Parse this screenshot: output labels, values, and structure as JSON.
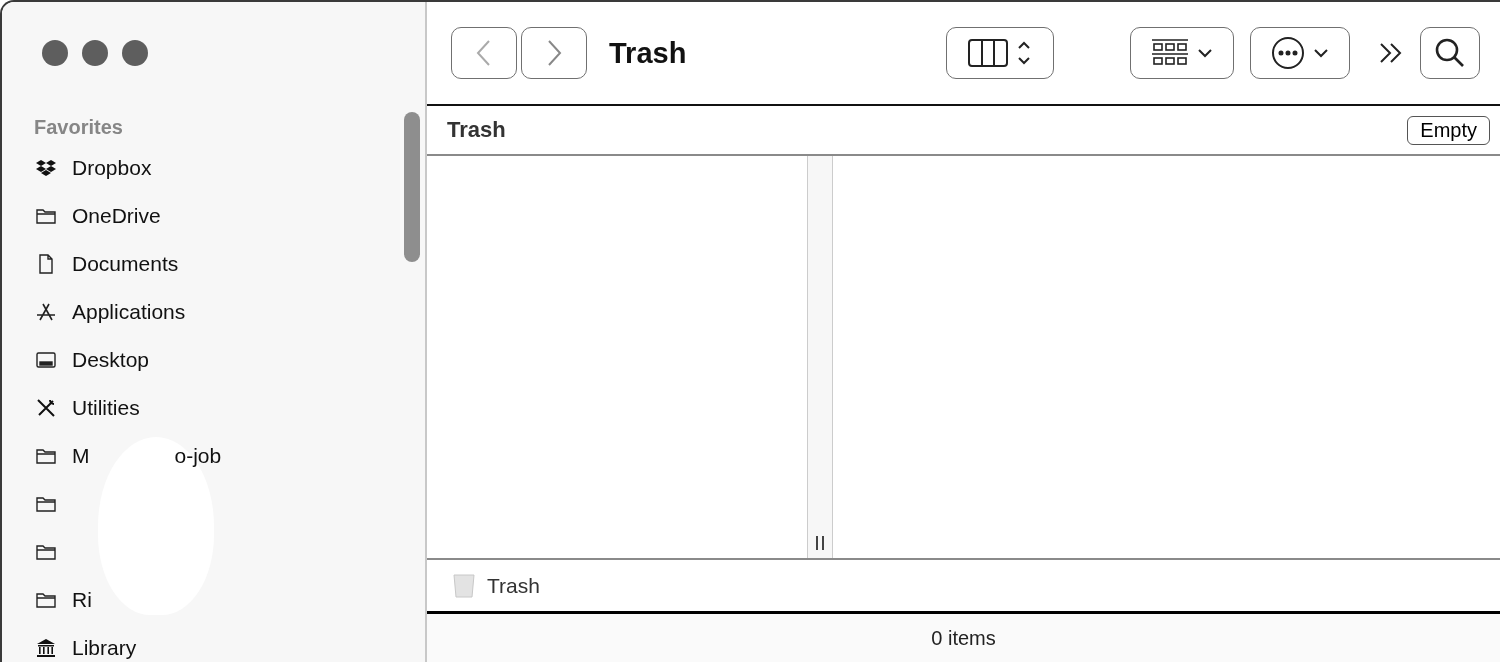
{
  "sidebar": {
    "section": "Favorites",
    "items": [
      {
        "kind": "dropbox",
        "label": "Dropbox"
      },
      {
        "kind": "folder",
        "label": "OneDrive"
      },
      {
        "kind": "document",
        "label": "Documents"
      },
      {
        "kind": "apps",
        "label": "Applications"
      },
      {
        "kind": "desktop",
        "label": "Desktop"
      },
      {
        "kind": "tools",
        "label": "Utilities"
      },
      {
        "kind": "folder",
        "label": "M",
        "label_end": "o-job"
      },
      {
        "kind": "folder"
      },
      {
        "kind": "folder"
      },
      {
        "kind": "folder",
        "label": "Ri"
      },
      {
        "kind": "library",
        "label": "Library"
      }
    ]
  },
  "toolbar": {
    "title": "Trash"
  },
  "path_header": {
    "title": "Trash",
    "button": "Empty"
  },
  "path_bar": {
    "label": "Trash"
  },
  "status_bar": "0 items"
}
